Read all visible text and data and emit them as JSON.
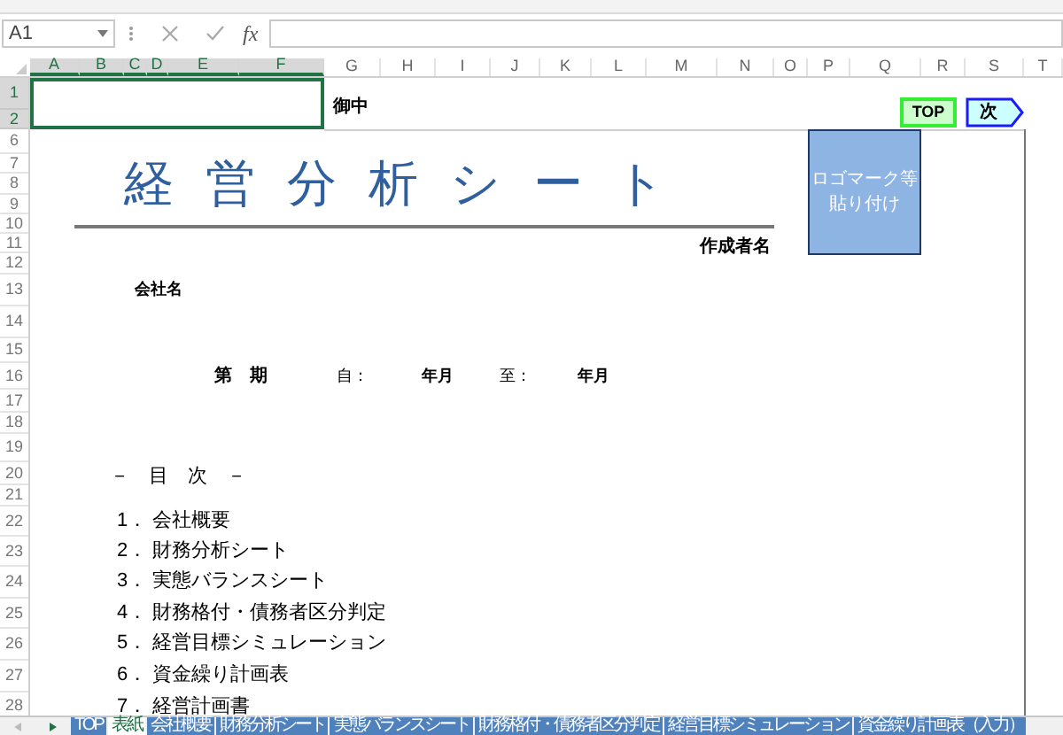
{
  "formula_bar": {
    "name_box": "A1",
    "function_label": "fx"
  },
  "column_headers": [
    {
      "label": "A",
      "selected": true
    },
    {
      "label": "B",
      "selected": true
    },
    {
      "label": "C",
      "selected": true
    },
    {
      "label": "D",
      "selected": true
    },
    {
      "label": "E",
      "selected": true
    },
    {
      "label": "F",
      "selected": true
    },
    {
      "label": "G",
      "selected": false
    },
    {
      "label": "H",
      "selected": false
    },
    {
      "label": "I",
      "selected": false
    },
    {
      "label": "J",
      "selected": false
    },
    {
      "label": "K",
      "selected": false
    },
    {
      "label": "L",
      "selected": false
    },
    {
      "label": "M",
      "selected": false
    },
    {
      "label": "N",
      "selected": false
    },
    {
      "label": "O",
      "selected": false
    },
    {
      "label": "P",
      "selected": false
    },
    {
      "label": "Q",
      "selected": false
    },
    {
      "label": "R",
      "selected": false
    },
    {
      "label": "S",
      "selected": false
    },
    {
      "label": "T",
      "selected": false
    }
  ],
  "row_headers": [
    {
      "label": "1",
      "selected": true
    },
    {
      "label": "2",
      "selected": true
    },
    {
      "label": "6",
      "selected": false
    },
    {
      "label": "7",
      "selected": false
    },
    {
      "label": "8",
      "selected": false
    },
    {
      "label": "9",
      "selected": false
    },
    {
      "label": "10",
      "selected": false
    },
    {
      "label": "11",
      "selected": false
    },
    {
      "label": "12",
      "selected": false
    },
    {
      "label": "13",
      "selected": false
    },
    {
      "label": "14",
      "selected": false
    },
    {
      "label": "15",
      "selected": false
    },
    {
      "label": "16",
      "selected": false
    },
    {
      "label": "17",
      "selected": false
    },
    {
      "label": "18",
      "selected": false
    },
    {
      "label": "19",
      "selected": false
    },
    {
      "label": "20",
      "selected": false
    },
    {
      "label": "21",
      "selected": false
    },
    {
      "label": "22",
      "selected": false
    },
    {
      "label": "23",
      "selected": false
    },
    {
      "label": "24",
      "selected": false
    },
    {
      "label": "25",
      "selected": false
    },
    {
      "label": "26",
      "selected": false
    },
    {
      "label": "27",
      "selected": false
    },
    {
      "label": "28",
      "selected": false
    }
  ],
  "sheet": {
    "addressee": "御中",
    "top_button": "TOP",
    "next_button": "次",
    "title": "経営分析シート",
    "logo_placeholder": "ロゴマーク等貼り付け",
    "author_label": "作成者名",
    "company_label": "会社名",
    "period": {
      "term": "第　期",
      "from_label": "自：",
      "from_value": "年月",
      "to_label": "至：",
      "to_value": "年月"
    },
    "toc_heading": "－　目　次　－",
    "toc": [
      {
        "number": "1．",
        "title": "会社概要"
      },
      {
        "number": "2．",
        "title": "財務分析シート"
      },
      {
        "number": "3．",
        "title": "実態バランスシート"
      },
      {
        "number": "4．",
        "title": "財務格付・債務者区分判定"
      },
      {
        "number": "5．",
        "title": "経営目標シミュレーション"
      },
      {
        "number": "6．",
        "title": "資金繰り計画表"
      },
      {
        "number": "7．",
        "title": "経営計画書"
      }
    ]
  },
  "sheet_tabs": [
    {
      "label": "TOP",
      "selected": false
    },
    {
      "label": "表紙",
      "selected": true
    },
    {
      "label": "会社概要",
      "selected": false
    },
    {
      "label": "財務分析シート",
      "selected": false
    },
    {
      "label": "実態バランスシート",
      "selected": false
    },
    {
      "label": "財務格付・債務者区分判定",
      "selected": false
    },
    {
      "label": "経営目標シミュレーション",
      "selected": false
    },
    {
      "label": "資金繰り計画表（入力）",
      "selected": false
    }
  ]
}
